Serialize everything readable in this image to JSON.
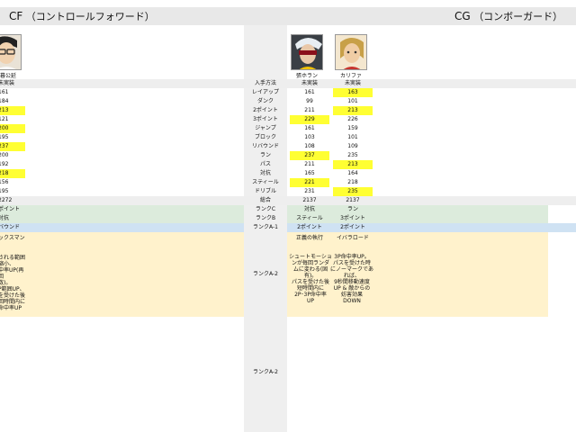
{
  "header": {
    "cf_title": "CF",
    "cf_sub": "（コントロールフォワード）",
    "cg_title": "CG",
    "cg_sub": "（コンボーガード）"
  },
  "players": {
    "left": {
      "name": "暮公延"
    },
    "p1": {
      "name": "張ホラン"
    },
    "p2": {
      "name": "カリファ"
    }
  },
  "stats": {
    "header_row": {
      "left": "未実装",
      "label": "入手方法",
      "p1": "未実装",
      "p2": "未実装"
    },
    "rows": [
      {
        "left": "161",
        "label": "レイアップ",
        "p1": "161",
        "p2": "163"
      },
      {
        "left": "184",
        "label": "ダンク",
        "p1": "99",
        "p2": "101"
      },
      {
        "left": "213",
        "label": "2ポイント",
        "p1": "211",
        "p2": "213"
      },
      {
        "left": "121",
        "label": "3ポイント",
        "p1": "229",
        "p2": "226"
      },
      {
        "left": "200",
        "label": "ジャンプ",
        "p1": "161",
        "p2": "159"
      },
      {
        "left": "195",
        "label": "ブロック",
        "p1": "103",
        "p2": "101"
      },
      {
        "left": "237",
        "label": "リバウンド",
        "p1": "108",
        "p2": "109"
      },
      {
        "left": "200",
        "label": "ラン",
        "p1": "237",
        "p2": "235"
      },
      {
        "left": "192",
        "label": "パス",
        "p1": "211",
        "p2": "213"
      },
      {
        "left": "218",
        "label": "対抗",
        "p1": "165",
        "p2": "164"
      },
      {
        "left": "156",
        "label": "スティール",
        "p1": "221",
        "p2": "218"
      },
      {
        "left": "195",
        "label": "ドリブル",
        "p1": "231",
        "p2": "235"
      }
    ],
    "total": {
      "left": "2272",
      "label": "総合",
      "p1": "2137",
      "p2": "2137"
    }
  },
  "ranks": {
    "c": {
      "left": "ポイント",
      "label": "ランクC",
      "p1": "対抗",
      "p2": "ラン"
    },
    "b": {
      "left": "対抗",
      "label": "ランクB",
      "p1": "スティール",
      "p2": "3ポイント"
    },
    "a1": {
      "left": "バウンド",
      "label": "ランクA-1",
      "p1": "2ポイント",
      "p2": "2ポイント"
    },
    "a2": {
      "left_title": "ックスマン",
      "label": "ランクA-2",
      "p1_title": "正義の執行",
      "p2_title": "イバラロード",
      "left_desc": "される範囲\n縮小、\n中率UP(再回\n数)。\nP範囲UP、\nを受けた後\n回時間内に\n命中率UP",
      "p1_desc": "シュートモーショ\nンが毎回ランダ\nムに変わる(固\n有)。\nパスを受けた後\n短時間内に\n2P･3P命中率\nUP",
      "p2_desc": "3P命中率UP。\nパスを受けた時\nにノーマークであ\nれば、\n9秒間移動速度\nUP & 敵からの\n妨害効果\nDOWN"
    },
    "a2b": {
      "label": "ランクA-2"
    }
  },
  "colors": {
    "highlight": "#ffff33",
    "green": "#dcebdc",
    "blue": "#cfe2f3",
    "cream": "#fff2cc",
    "gray": "#eeeeee"
  }
}
